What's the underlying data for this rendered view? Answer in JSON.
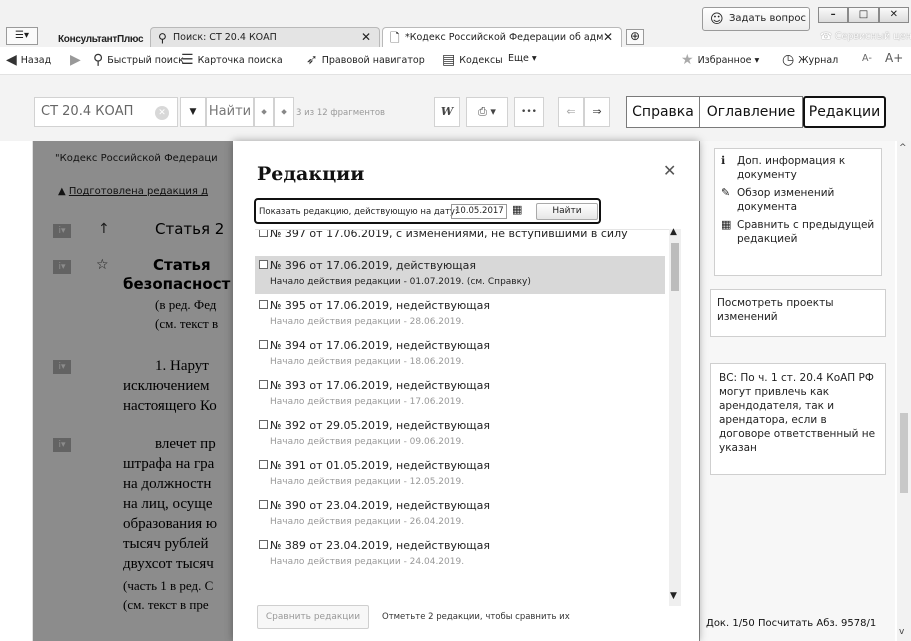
{
  "tabs": {
    "menu_label": "☰▾",
    "app_name": "КонсультантПлюс",
    "tab1": "Поиск: СТ 20.4 КОАП",
    "tab2": "*Кодекс Российской Федерации об адм",
    "ask": "Задать вопрос",
    "service_center": "Сервисный центр"
  },
  "toolbar": {
    "back": "Назад",
    "quick_search": "Быстрый поиск",
    "card_search": "Карточка поиска",
    "legal_nav": "Правовой навигатор",
    "codes": "Кодексы",
    "more": "Еще ▾",
    "favorites": "Избранное ▾",
    "journal": "Журнал",
    "font_small": "А-",
    "font_large": "А+"
  },
  "search": {
    "value": "СТ 20.4 КОАП",
    "find": "Найти",
    "fragments": "3 из 12 фрагментов",
    "word_icon": "W",
    "print_icon": "⎙ ▾",
    "more_icon": "•••"
  },
  "right_tabs": {
    "help": "Справка",
    "contents": "Оглавление",
    "editions": "Редакции"
  },
  "doc": {
    "head": "\"Кодекс Российской Федераци",
    "warning": "Подготовлена редакция д",
    "art1": "Статья 2",
    "art2": "Статья",
    "line1": "безопасност",
    "line2": "(в ред. Фед",
    "line3": "(см. текст в",
    "p1a": "1.   Нарут",
    "p1b": "исключением",
    "p1c": "настоящего Ко",
    "p2a": "влечет   пр",
    "p2b": "штрафа на гра",
    "p2c": "на должностн",
    "p2d": "на лиц, осуще",
    "p2e": "образования ю",
    "p2f": "тысяч рублей",
    "p2g": "двухсот тысяч",
    "p2h": "(часть 1 в ред. С",
    "p2i": "(см. текст в пре",
    "i_badge": "i▾"
  },
  "side": {
    "link1": "Доп. информация к документу",
    "link2": "Обзор изменений документа",
    "link3": "Сравнить с предыдущей редакцией",
    "projects": "Посмотреть проекты изменений",
    "vs_note": "ВС: По ч. 1 ст. 20.4 КоАП РФ могут привлечь как арендодателя, так и арендатора, если в договоре ответственный не указан",
    "status": "Док. 1/50 Посчитать Абз. 9578/1"
  },
  "modal": {
    "title": "Редакции",
    "date_label": "Показать редакцию, действующую на дату:",
    "date_value": "10.05.2017",
    "find": "Найти",
    "compare_btn": "Сравнить редакции",
    "compare_hint": "Отметьте 2 редакции, чтобы сравнить их",
    "editions": [
      {
        "title": "№ 397 от 17.06.2019, с изменениями, не вступившими в силу",
        "sub": ""
      },
      {
        "title": "№ 396 от 17.06.2019, действующая",
        "sub": "Начало действия редакции - 01.07.2019. (см. Справку)"
      },
      {
        "title": "№ 395 от 17.06.2019, недействующая",
        "sub": "Начало действия редакции - 28.06.2019."
      },
      {
        "title": "№ 394 от 17.06.2019, недействующая",
        "sub": "Начало действия редакции - 18.06.2019."
      },
      {
        "title": "№ 393 от 17.06.2019, недействующая",
        "sub": "Начало действия редакции - 17.06.2019."
      },
      {
        "title": "№ 392 от 29.05.2019, недействующая",
        "sub": "Начало действия редакции - 09.06.2019."
      },
      {
        "title": "№ 391 от 01.05.2019, недействующая",
        "sub": "Начало действия редакции - 12.05.2019."
      },
      {
        "title": "№ 390 от 23.04.2019, недействующая",
        "sub": "Начало действия редакции - 26.04.2019."
      },
      {
        "title": "№ 389 от 23.04.2019, недействующая",
        "sub": "Начало действия редакции - 24.04.2019."
      }
    ]
  }
}
